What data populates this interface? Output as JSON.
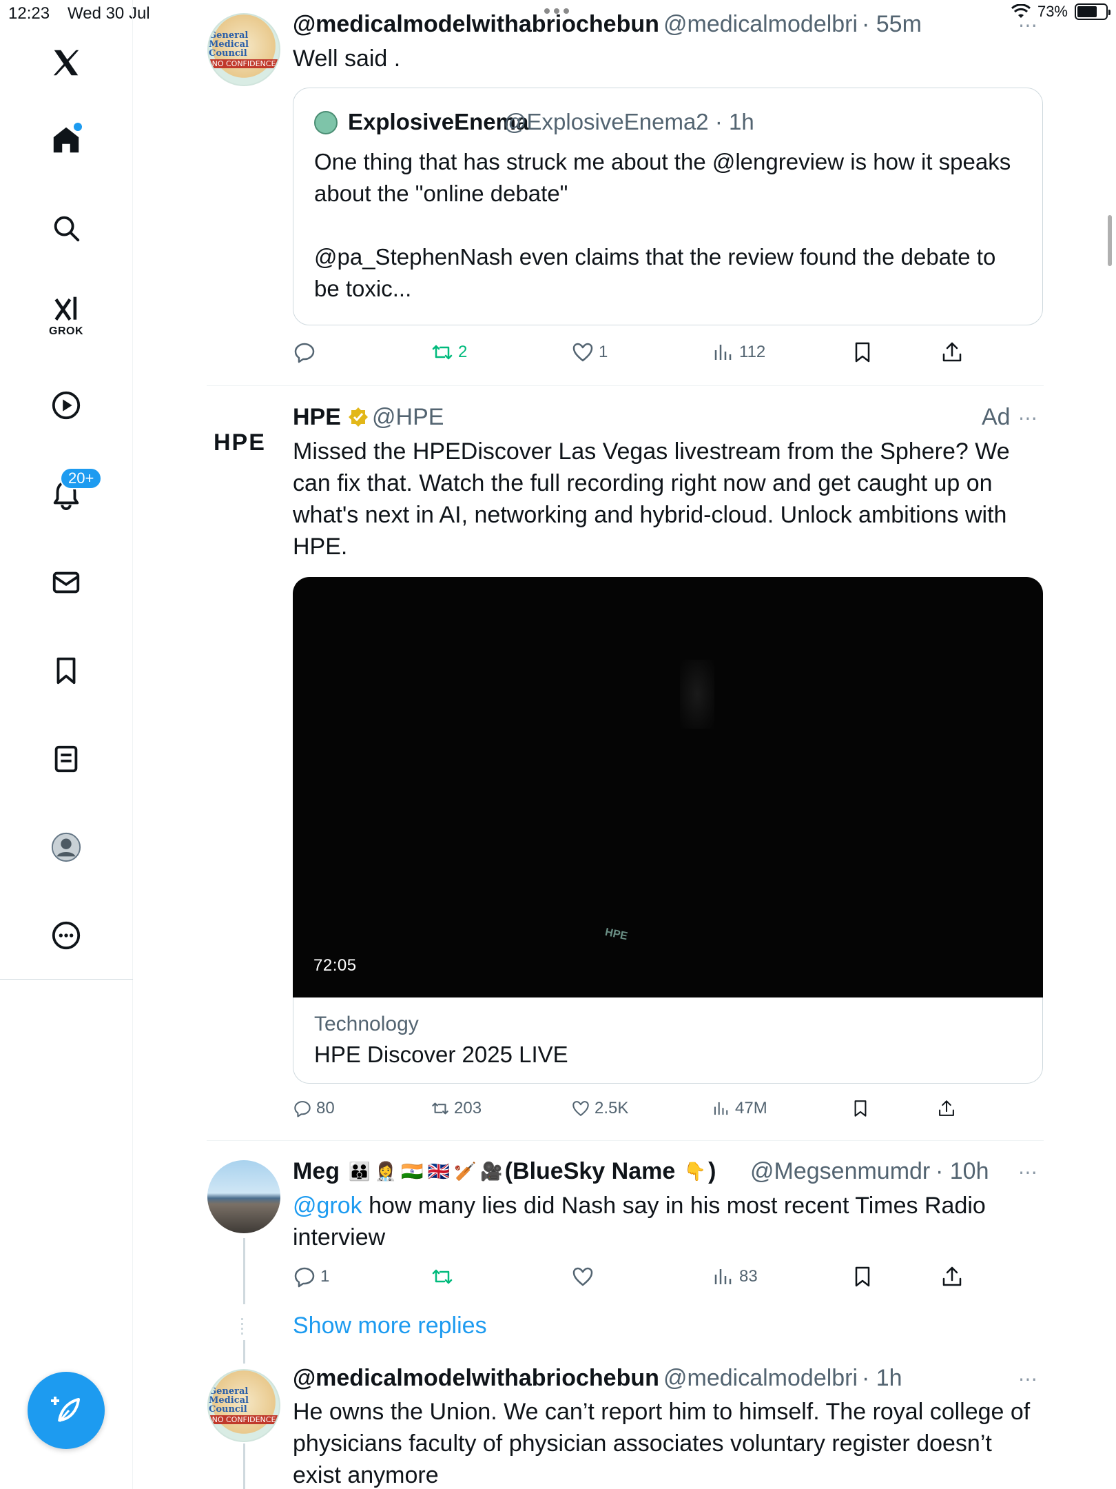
{
  "status_bar": {
    "time": "12:23",
    "date": "Wed 30 Jul",
    "battery": "73%",
    "battery_level": 0.73
  },
  "sidebar": {
    "grok_label": "GROK",
    "notifications_badge": "20+",
    "icons": [
      "x-logo-icon",
      "home-icon",
      "search-icon",
      "grok-icon",
      "video-icon",
      "bell-icon",
      "mail-icon",
      "bookmark-icon",
      "lists-icon",
      "profile-icon",
      "more-icon",
      "compose-icon"
    ],
    "accent_color": "#1d9bf0"
  },
  "tweets": [
    {
      "name": "@medicalmodelwithabriochebun",
      "handle": "@medicalmodelbri",
      "time": "· 55m",
      "avatar_label_1": "General Medical Council",
      "avatar_label_2": "NO CONFIDENCE",
      "text": "Well said .",
      "quote": {
        "name": "ExplosiveEnema",
        "handle": "@ExplosiveEnema2 · 1h",
        "text_1": "One thing that has struck me about the @lengreview is how it speaks about the \"online debate\"",
        "text_2": "@pa_StephenNash even claims that the review found the debate to be toxic..."
      },
      "actions": {
        "reply": "",
        "repost": "2",
        "like": "1",
        "views": "112"
      }
    },
    {
      "name": "HPE",
      "handle": "@HPE",
      "ad_label": "Ad",
      "logo_text": "HPE",
      "text": "Missed the HPEDiscover Las Vegas livestream from the Sphere? We can fix that. Watch the full recording right now and get caught up on what's next in AI, networking and hybrid-cloud. Unlock ambitions with HPE.",
      "video": {
        "duration": "72:05",
        "watermark": "HPE",
        "category": "Technology",
        "title": "HPE Discover 2025 LIVE"
      },
      "actions": {
        "reply": "80",
        "repost": "203",
        "like": "2.5K",
        "views": "47M"
      }
    },
    {
      "name": "Meg",
      "name_suffix": "(BlueSky Name",
      "name_end": ")",
      "handle": "@Megsenmumdr",
      "time": "· 10h",
      "mention": "@grok",
      "text": "how many lies did Nash say in his most recent Times Radio interview",
      "actions": {
        "reply": "1",
        "repost": "",
        "like": "",
        "views": "83"
      }
    },
    {
      "show_more": "Show more replies"
    },
    {
      "name": "@medicalmodelwithabriochebun",
      "handle": "@medicalmodelbri",
      "time": "· 1h",
      "text": "He owns the Union. We can’t report him to himself. The royal college of physicians faculty of physician associates voluntary register doesn’t exist anymore"
    }
  ]
}
